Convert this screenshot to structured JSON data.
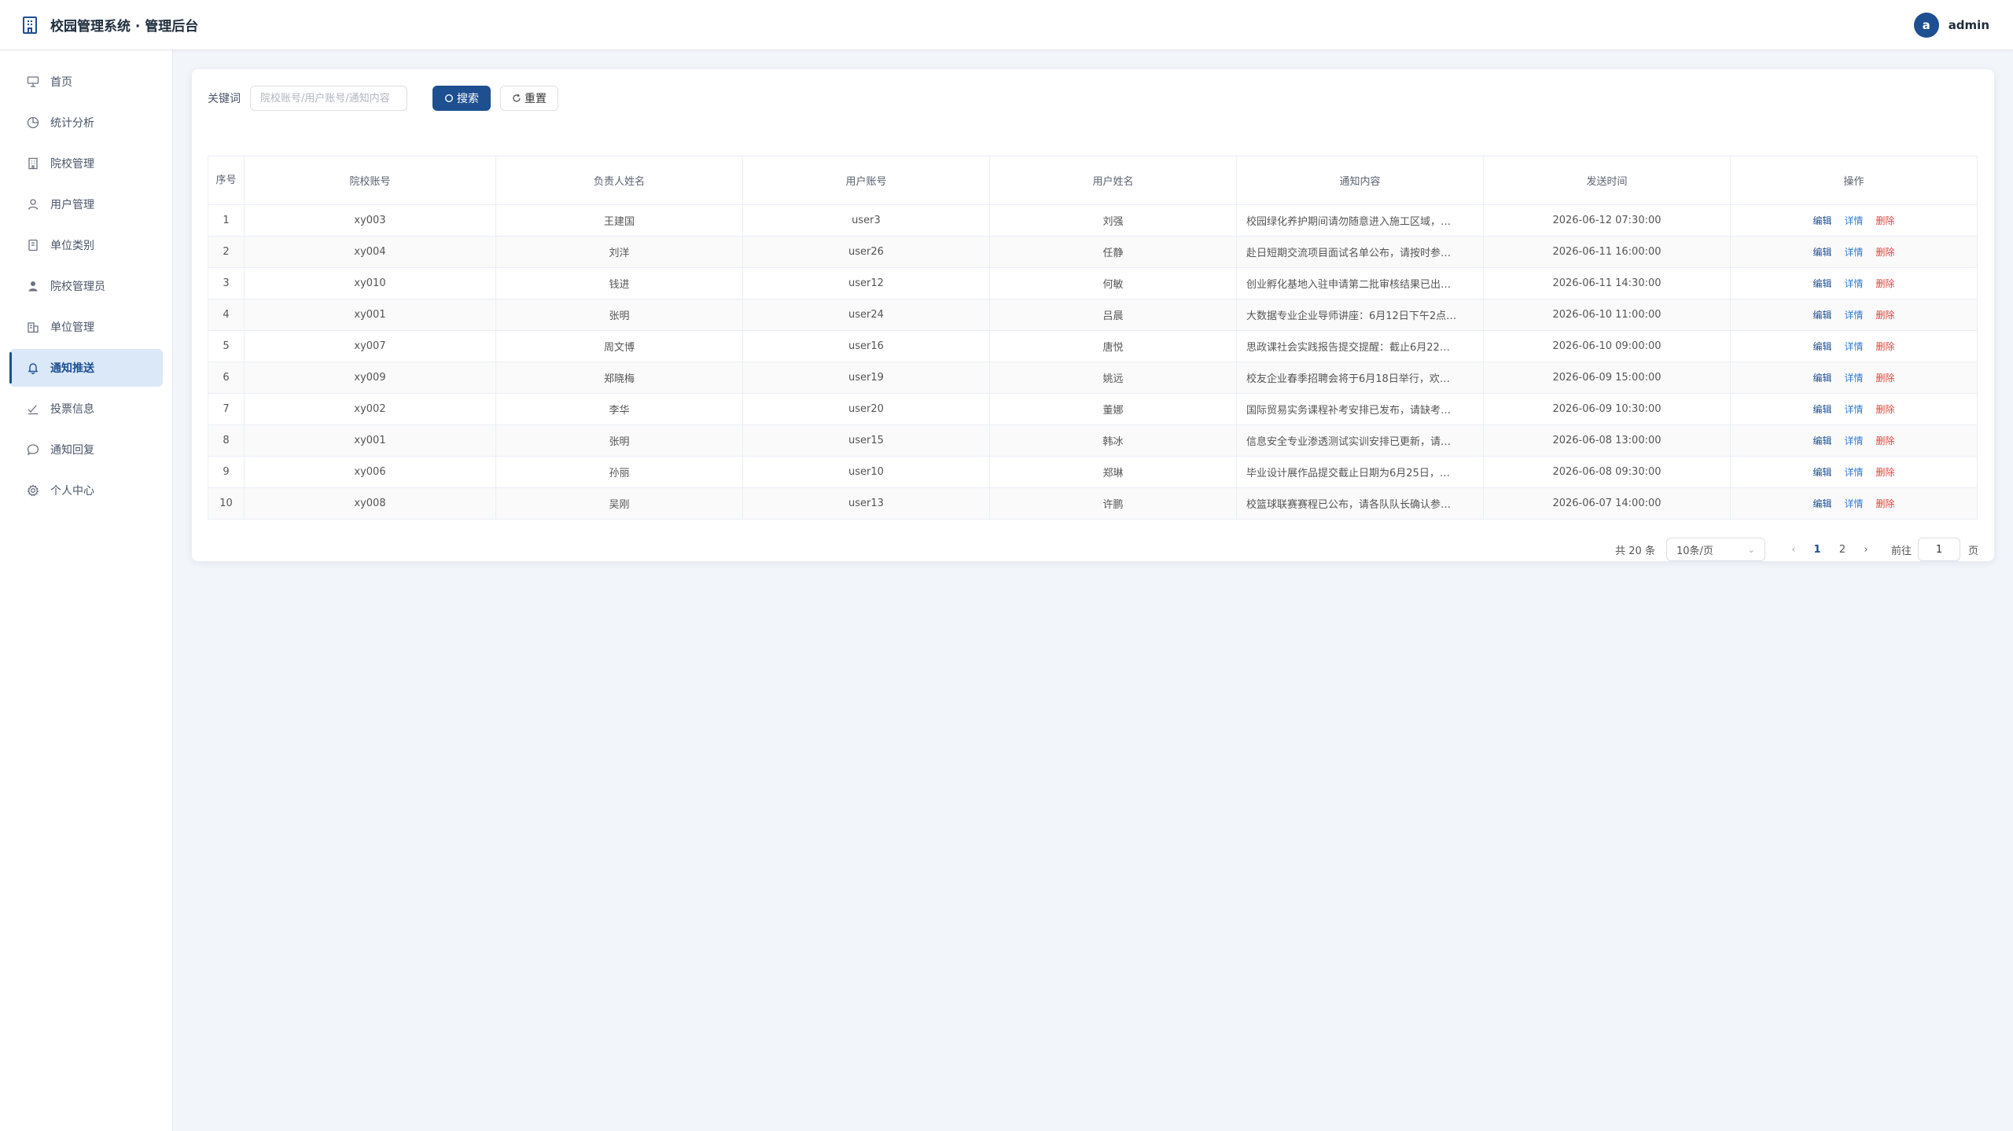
{
  "app": {
    "title": "校园管理系统 · 管理后台",
    "user": {
      "avatar_letter": "a",
      "name": "admin"
    }
  },
  "sidebar": {
    "items": [
      {
        "label": "首页",
        "icon": "home-board-icon",
        "active": false
      },
      {
        "label": "统计分析",
        "icon": "pie-chart-icon",
        "active": false
      },
      {
        "label": "院校管理",
        "icon": "building-icon",
        "active": false
      },
      {
        "label": "用户管理",
        "icon": "user-icon",
        "active": false
      },
      {
        "label": "单位类别",
        "icon": "category-book-icon",
        "active": false
      },
      {
        "label": "院校管理员",
        "icon": "admin-user-icon",
        "active": false
      },
      {
        "label": "单位管理",
        "icon": "office-building-icon",
        "active": false
      },
      {
        "label": "通知推送",
        "icon": "bell-icon",
        "active": true
      },
      {
        "label": "投票信息",
        "icon": "vote-icon",
        "active": false
      },
      {
        "label": "通知回复",
        "icon": "chat-bubble-icon",
        "active": false
      },
      {
        "label": "个人中心",
        "icon": "gear-icon",
        "active": false
      }
    ]
  },
  "search": {
    "label": "关键词",
    "placeholder": "院校账号/用户账号/通知内容",
    "search_button": "搜索",
    "reset_button": "重置"
  },
  "table": {
    "headers": [
      "序号",
      "院校账号",
      "负责人姓名",
      "用户账号",
      "用户姓名",
      "通知内容",
      "发送时间",
      "操作"
    ],
    "actions": {
      "edit": "编辑",
      "detail": "详情",
      "delete": "删除"
    },
    "rows": [
      {
        "idx": "1",
        "school": "xy003",
        "manager": "王建国",
        "account": "user3",
        "name": "刘强",
        "content": "校园绿化养护期间请勿随意进入施工区域，…",
        "time": "2026-06-12 07:30:00"
      },
      {
        "idx": "2",
        "school": "xy004",
        "manager": "刘洋",
        "account": "user26",
        "name": "任静",
        "content": "赴日短期交流项目面试名单公布，请按时参…",
        "time": "2026-06-11 16:00:00"
      },
      {
        "idx": "3",
        "school": "xy010",
        "manager": "钱进",
        "account": "user12",
        "name": "何敏",
        "content": "创业孵化基地入驻申请第二批审核结果已出…",
        "time": "2026-06-11 14:30:00"
      },
      {
        "idx": "4",
        "school": "xy001",
        "manager": "张明",
        "account": "user24",
        "name": "吕晨",
        "content": "大数据专业企业导师讲座：6月12日下午2点…",
        "time": "2026-06-10 11:00:00"
      },
      {
        "idx": "5",
        "school": "xy007",
        "manager": "周文博",
        "account": "user16",
        "name": "唐悦",
        "content": "思政课社会实践报告提交提醒：截止6月22…",
        "time": "2026-06-10 09:00:00"
      },
      {
        "idx": "6",
        "school": "xy009",
        "manager": "郑晓梅",
        "account": "user19",
        "name": "姚远",
        "content": "校友企业春季招聘会将于6月18日举行，欢…",
        "time": "2026-06-09 15:00:00"
      },
      {
        "idx": "7",
        "school": "xy002",
        "manager": "李华",
        "account": "user20",
        "name": "董娜",
        "content": "国际贸易实务课程补考安排已发布，请缺考…",
        "time": "2026-06-09 10:30:00"
      },
      {
        "idx": "8",
        "school": "xy001",
        "manager": "张明",
        "account": "user15",
        "name": "韩冰",
        "content": "信息安全专业渗透测试实训安排已更新，请…",
        "time": "2026-06-08 13:00:00"
      },
      {
        "idx": "9",
        "school": "xy006",
        "manager": "孙丽",
        "account": "user10",
        "name": "郑琳",
        "content": "毕业设计展作品提交截止日期为6月25日，…",
        "time": "2026-06-08 09:30:00"
      },
      {
        "idx": "10",
        "school": "xy008",
        "manager": "吴刚",
        "account": "user13",
        "name": "许鹏",
        "content": "校篮球联赛赛程已公布，请各队队长确认参…",
        "time": "2026-06-07 14:00:00"
      }
    ]
  },
  "pagination": {
    "total_text": "共 20 条",
    "page_size": "10条/页",
    "pages": [
      "1",
      "2"
    ],
    "current_page": "1",
    "goto_label": "前往",
    "goto_value": "1",
    "page_suffix": "页"
  },
  "colors": {
    "primary": "#1d4f91",
    "danger": "#e0453a",
    "link": "#2f7ad1",
    "background": "#f2f5fa"
  }
}
